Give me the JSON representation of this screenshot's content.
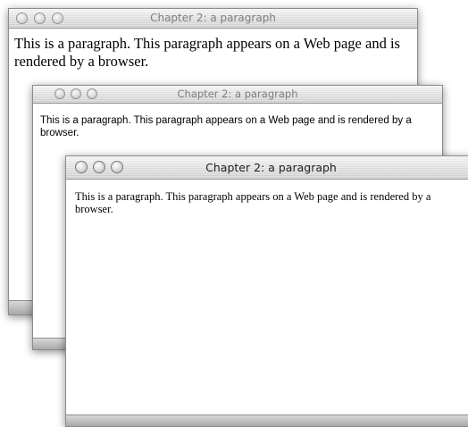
{
  "windows": [
    {
      "title": "Chapter 2: a paragraph",
      "paragraph": "This is a paragraph. This paragraph appears on a Web page and is rendered by a browser."
    },
    {
      "title": "Chapter 2: a paragraph",
      "paragraph": "This is a paragraph. This paragraph appears on a Web page and is rendered by a browser."
    },
    {
      "title": "Chapter 2: a paragraph",
      "paragraph": "This is a paragraph. This paragraph appears on a Web page and is rendered by a browser."
    }
  ]
}
